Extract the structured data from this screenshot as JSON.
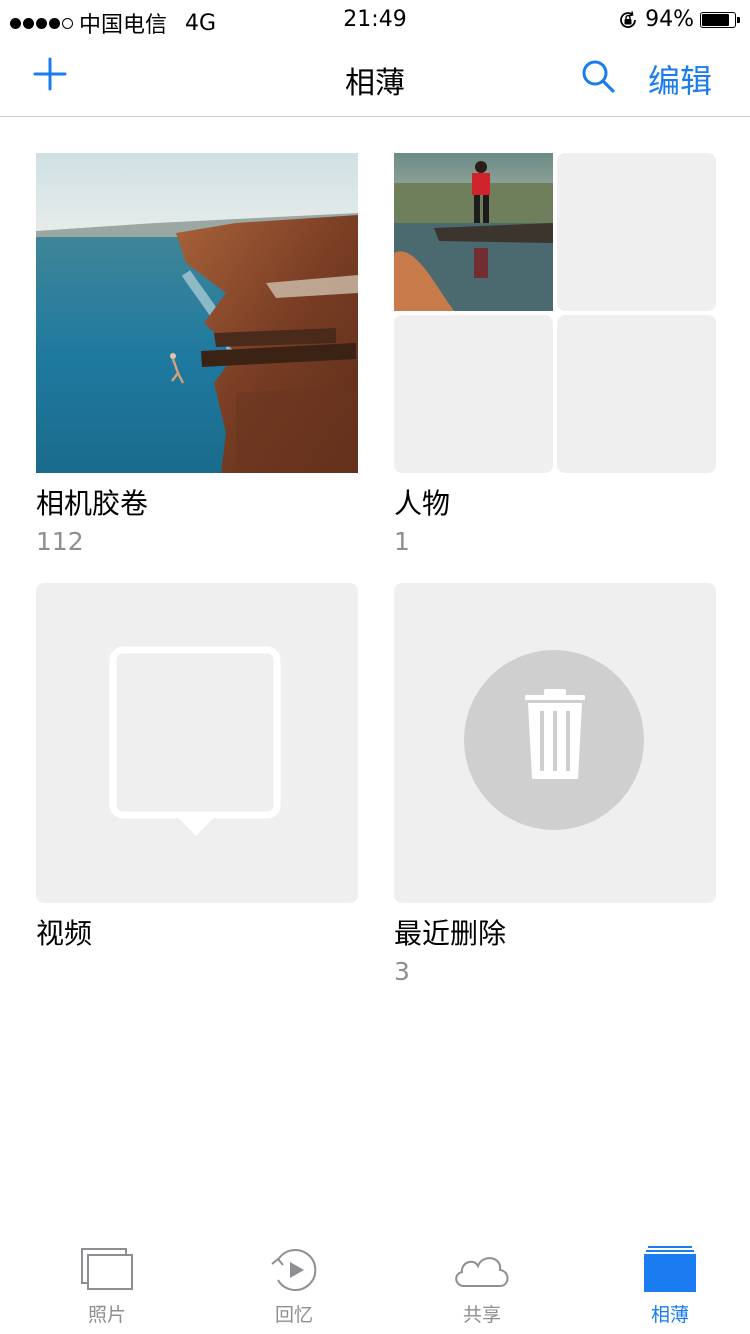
{
  "status_bar": {
    "carrier": "中国电信",
    "network": "4G",
    "time": "21:49",
    "battery": "94%",
    "battery_level": 0.94
  },
  "nav": {
    "title": "相薄",
    "edit_label": "编辑"
  },
  "albums": [
    {
      "title": "相机胶卷",
      "count": "112"
    },
    {
      "title": "人物",
      "count": "1"
    },
    {
      "title": "视频",
      "count": ""
    },
    {
      "title": "最近删除",
      "count": "3"
    }
  ],
  "tabs": [
    {
      "label": "照片",
      "icon": "photos-icon",
      "active": false
    },
    {
      "label": "回忆",
      "icon": "memories-icon",
      "active": false
    },
    {
      "label": "共享",
      "icon": "cloud-icon",
      "active": false
    },
    {
      "label": "相薄",
      "icon": "albums-icon",
      "active": true
    }
  ],
  "colors": {
    "accent": "#1a7cf0",
    "placeholder": "#efefef",
    "secondary_text": "#8e8e93"
  }
}
